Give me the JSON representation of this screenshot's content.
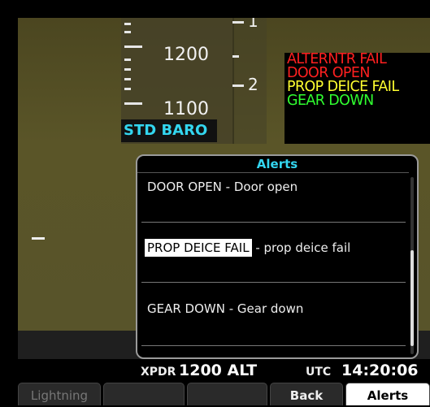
{
  "altimeter": {
    "labels": [
      "1200",
      "1100"
    ],
    "baro_mode": "STD BARO"
  },
  "vsi": {
    "labels": [
      "1",
      "2"
    ]
  },
  "crew_alerts": [
    {
      "text": "ALTERNTR FAIL",
      "color": "#ff2020"
    },
    {
      "text": "DOOR OPEN",
      "color": "#ff2020"
    },
    {
      "text": "PROP DEICE FAIL",
      "color": "#ffff30"
    },
    {
      "text": "GEAR DOWN",
      "color": "#30ff30"
    }
  ],
  "alerts_window": {
    "title": "Alerts",
    "items": [
      {
        "name": "DOOR OPEN",
        "sep": " - ",
        "desc": "Door open"
      },
      {
        "name": "PROP DEICE FAIL",
        "sep": " - ",
        "desc": "prop deice fail"
      },
      {
        "name": "GEAR DOWN",
        "sep": " - ",
        "desc": "Gear down"
      }
    ]
  },
  "status_bar": {
    "xpdr_label": "XPDR",
    "xpdr_value": "1200 ALT",
    "utc_label": "UTC",
    "utc_value": "14:20:06"
  },
  "softkeys": [
    "Lightning",
    "",
    "",
    "Back",
    "Alerts"
  ]
}
